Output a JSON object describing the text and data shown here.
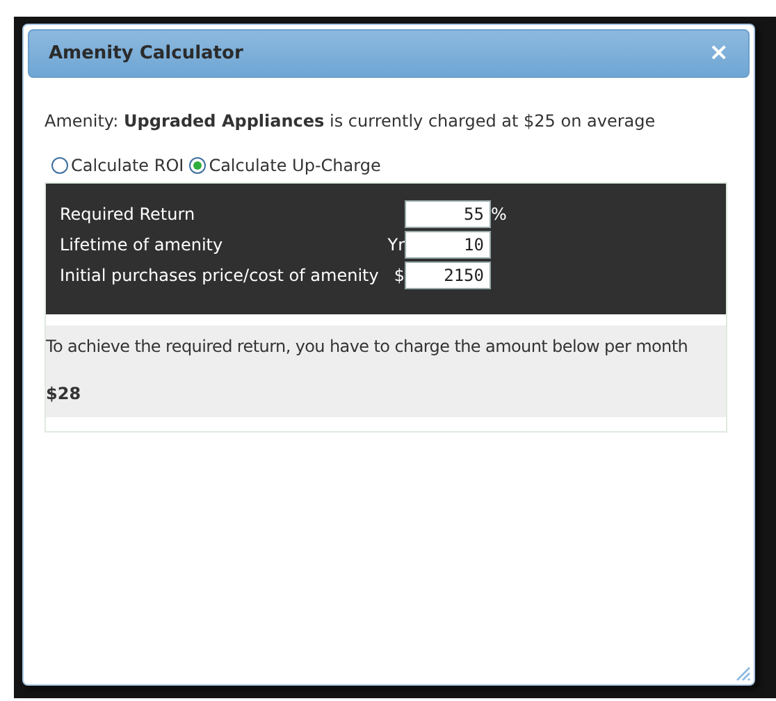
{
  "dialog": {
    "title": "Amenity Calculator",
    "close": "×"
  },
  "intro": "Amenity: **Upgraded Appliances** is currently charged at $25 on average",
  "modes": [
    {
      "label": "Calculate ROI",
      "selected": false
    },
    {
      "label": "Calculate Up-Charge",
      "selected": true
    }
  ],
  "inputs": [
    {
      "label": "Required Return",
      "value": "55",
      "unit": "%",
      "kind": "suffix"
    },
    {
      "label": "Lifetime of amenity",
      "value": "10",
      "unit": "Yr",
      "kind": "prefix"
    },
    {
      "label": "Initial purchases price/cost of amenity",
      "value": "2150",
      "unit": "$",
      "kind": "prefix"
    }
  ],
  "result": {
    "message": "To achieve the required return, you have to charge the amount below per month",
    "amount": "$28"
  }
}
